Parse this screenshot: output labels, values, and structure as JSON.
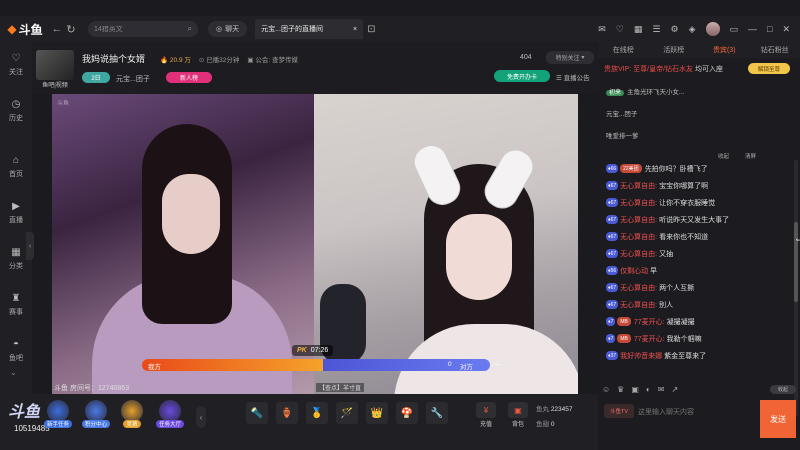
{
  "app": {
    "logo": "斗鱼"
  },
  "topbar": {
    "search_value": "14猎英文",
    "chat_label": "聊天",
    "tab_label": "元宝...团子的直播间"
  },
  "sidebar": {
    "items": [
      {
        "icon": "heart-icon",
        "label": "关注"
      },
      {
        "icon": "clock-icon",
        "label": "历史"
      },
      {
        "icon": "home-icon",
        "label": "首页"
      },
      {
        "icon": "live-icon",
        "label": "直播"
      },
      {
        "icon": "grid-icon",
        "label": "分类"
      },
      {
        "icon": "trophy-icon",
        "label": "赛事"
      },
      {
        "icon": "fish-icon",
        "label": "鱼吧"
      }
    ]
  },
  "room": {
    "avatar_label": "鱼吧|视频",
    "title": "我妈说抽个女婿",
    "heat": "20.9 万",
    "duration": "已播32分钟",
    "notice_tag": "公会: 查梦传媒",
    "level": "2日",
    "host_name": "元宝...团子",
    "new_tag": "新人榜",
    "viewer_count": "404",
    "follow_label": "特别关注",
    "free_label": "免费开办卡",
    "announcement_label": "直播公告"
  },
  "video": {
    "mark_left": "斗鱼",
    "pk_label": "PK",
    "timer": "07:26",
    "us_label": "我方",
    "us_score": 0,
    "them_score": "0",
    "them_label": "对方",
    "us_fraction": 0.52,
    "host_tag": "【查点】羊寸直",
    "room_id_text": "斗鱼 房间号：12740863"
  },
  "bottombar": {
    "room_no": "10519485",
    "tools": [
      {
        "label": "新手任务",
        "color": "#3b6fe0"
      },
      {
        "label": "积分中心",
        "color": "#4a7ae8"
      },
      {
        "label": "竞猜",
        "color": "#e6a12a"
      },
      {
        "label": "任务大厅",
        "color": "#6a4ae0"
      }
    ],
    "gifts": [
      "🔦",
      "🏺",
      "🥇",
      "🪄",
      "👑",
      "🍄",
      "🔧"
    ],
    "actions": [
      {
        "label": "充值",
        "glyph": "¥"
      },
      {
        "label": "背包",
        "glyph": "▣"
      }
    ],
    "fish_balls_label": "鱼丸",
    "fish_balls": "223457",
    "fish_fins_label": "鱼翅",
    "fish_fins": "0"
  },
  "chatpanel": {
    "tabs": [
      "在线榜",
      "活跃榜",
      "贵宾(3)",
      "钻石粉丝"
    ],
    "active_tab": 2,
    "noble_line_user": "贵族VIP: 至尊/皇帝/钻石水友",
    "noble_line_tail": "均可入座",
    "unlock_label": "解锁至尊",
    "entrances": [
      {
        "tag": "初来",
        "text": "主角光环飞天小女..."
      },
      {
        "tag": "",
        "text": "元宝...团子"
      },
      {
        "tag": "",
        "text": "唯爱排一爹"
      }
    ],
    "tools": [
      "收起",
      "清屏"
    ],
    "messages": [
      {
        "lv": "66",
        "fan": "22美团",
        "name": "",
        "text": "先拍你吗？卧槽飞了"
      },
      {
        "lv": "67",
        "fan": "",
        "name": "无心算自由:",
        "text": "宝宝你哪算了啊"
      },
      {
        "lv": "67",
        "fan": "",
        "name": "无心算自由:",
        "text": "让你不穿衣服睡觉"
      },
      {
        "lv": "67",
        "fan": "",
        "name": "无心算自由:",
        "text": "听说昨天又发生大事了"
      },
      {
        "lv": "67",
        "fan": "",
        "name": "无心算自由:",
        "text": "看来你也不知道"
      },
      {
        "lv": "67",
        "fan": "",
        "name": "无心算自由:",
        "text": "又抽"
      },
      {
        "lv": "56",
        "fan": "",
        "name": "仅剩心动",
        "text": "早"
      },
      {
        "lv": "67",
        "fan": "",
        "name": "无心算自由:",
        "text": "两个人互撕"
      },
      {
        "lv": "67",
        "fan": "",
        "name": "无心算自由:",
        "text": "别人"
      },
      {
        "lv": "7",
        "fan": "MB",
        "name": "77麦开心:",
        "text": "凝撮凝撮"
      },
      {
        "lv": "7",
        "fan": "MB",
        "name": "77麦开心:",
        "text": "我勒个帼嘛"
      },
      {
        "lv": "37",
        "fan": "",
        "name": "我好帅音来娜",
        "text": "紫金至尊来了"
      }
    ],
    "collapse_label": "收起",
    "input_badge": "斗鱼TV",
    "input_placeholder": "这里输入聊天内容",
    "send_label": "发送"
  }
}
